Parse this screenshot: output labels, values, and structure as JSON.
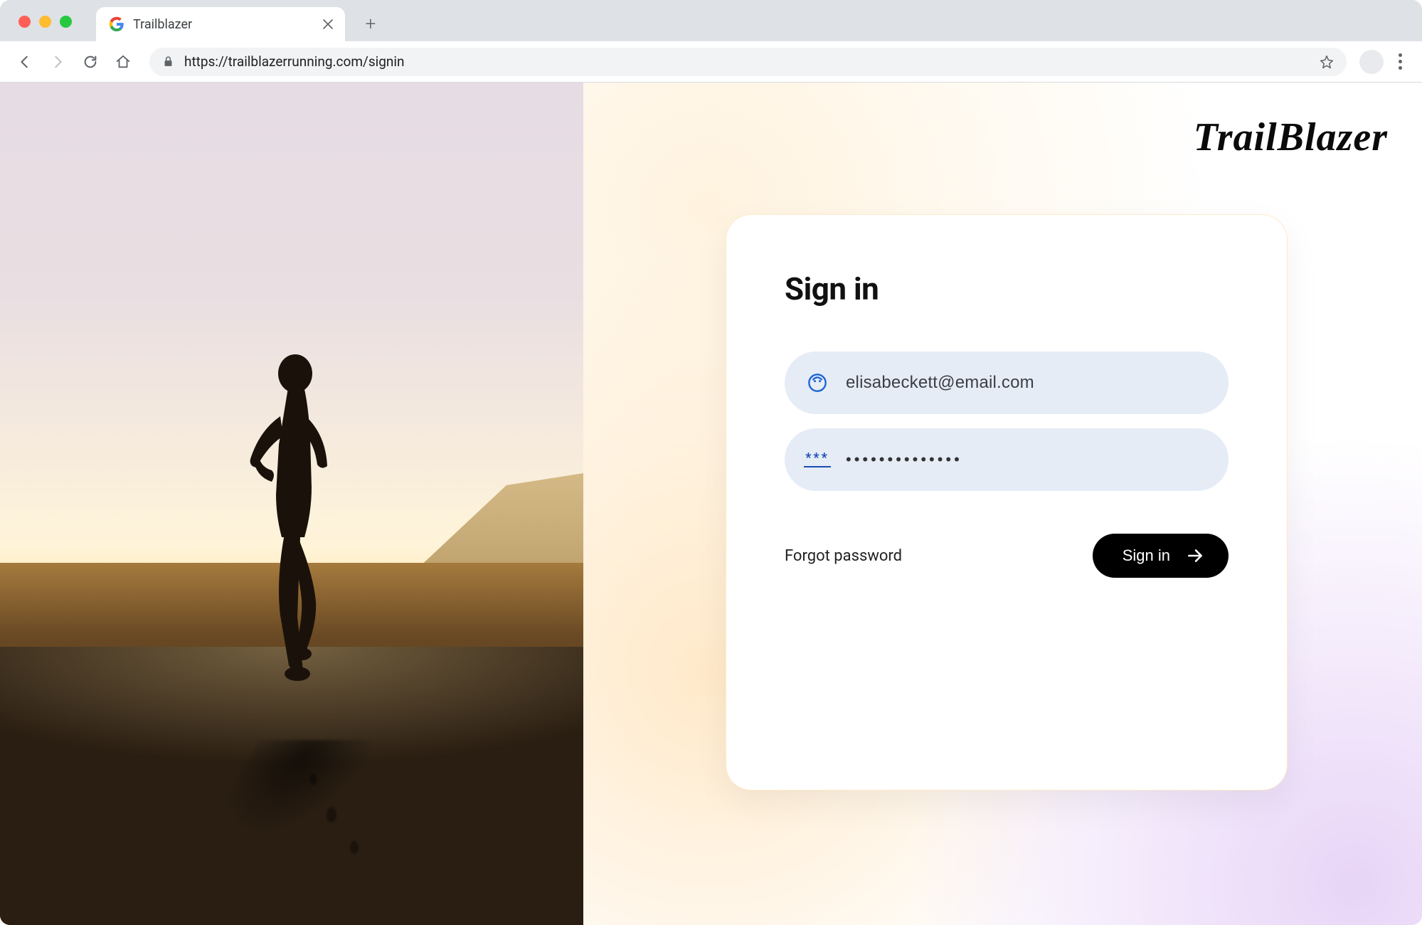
{
  "browser": {
    "tab_title": "Trailblazer",
    "url": "https://trailblazerrunning.com/signin"
  },
  "brand": "TrailBlazer",
  "signin": {
    "heading": "Sign in",
    "email_value": "elisabeckett@email.com",
    "password_value": "••••••••••••••",
    "forgot_label": "Forgot password",
    "submit_label": "Sign in"
  }
}
